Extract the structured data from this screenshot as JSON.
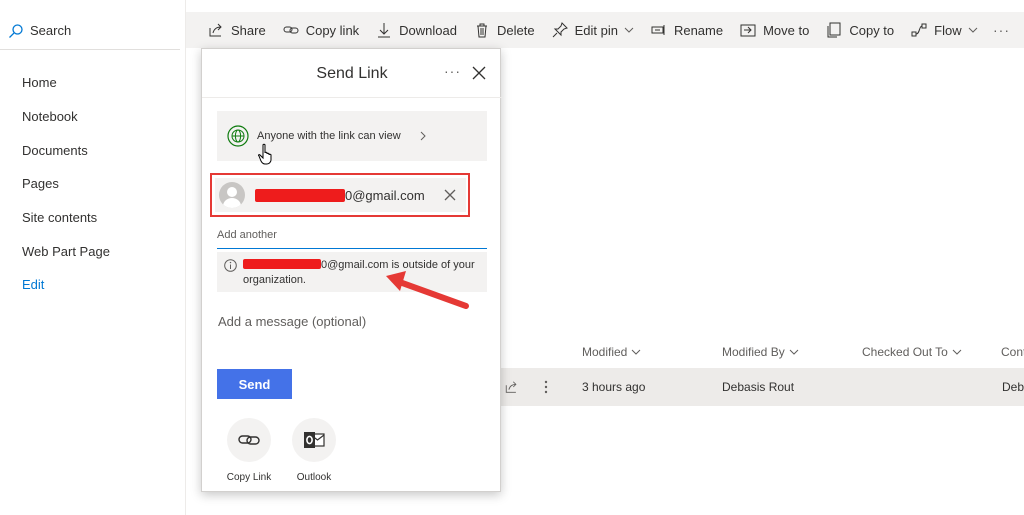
{
  "search": {
    "label": "Search"
  },
  "nav": {
    "items": [
      {
        "label": "Home"
      },
      {
        "label": "Notebook"
      },
      {
        "label": "Documents"
      },
      {
        "label": "Pages"
      },
      {
        "label": "Site contents"
      },
      {
        "label": "Web Part Page"
      },
      {
        "label": "Edit"
      }
    ]
  },
  "commandbar": {
    "share": "Share",
    "copy_link": "Copy link",
    "download": "Download",
    "delete": "Delete",
    "edit_pin": "Edit pin",
    "rename": "Rename",
    "move_to": "Move to",
    "copy_to": "Copy to",
    "flow": "Flow",
    "more": "···"
  },
  "filelist": {
    "columns": {
      "modified": "Modified",
      "modified_by": "Modified By",
      "checked_out_to": "Checked Out To",
      "content": "Cont"
    },
    "row": {
      "modified": "3 hours ago",
      "modified_by": "Debasis Rout",
      "content": "Deba"
    }
  },
  "dialog": {
    "title": "Send Link",
    "more": "···",
    "permission": "Anyone with the link can view",
    "recipient_suffix": "0@gmail.com",
    "add_another": "Add another",
    "warning_email_suffix": "0@gmail.com",
    "warning_text": " is outside of your organization.",
    "message_placeholder": "Add a message (optional)",
    "send_label": "Send",
    "apps": [
      {
        "label": "Copy Link"
      },
      {
        "label": "Outlook"
      }
    ]
  },
  "colors": {
    "accent": "#0078d4",
    "send_button": "#4472e8",
    "highlight": "#e53935",
    "redaction": "#ee1c1c"
  }
}
